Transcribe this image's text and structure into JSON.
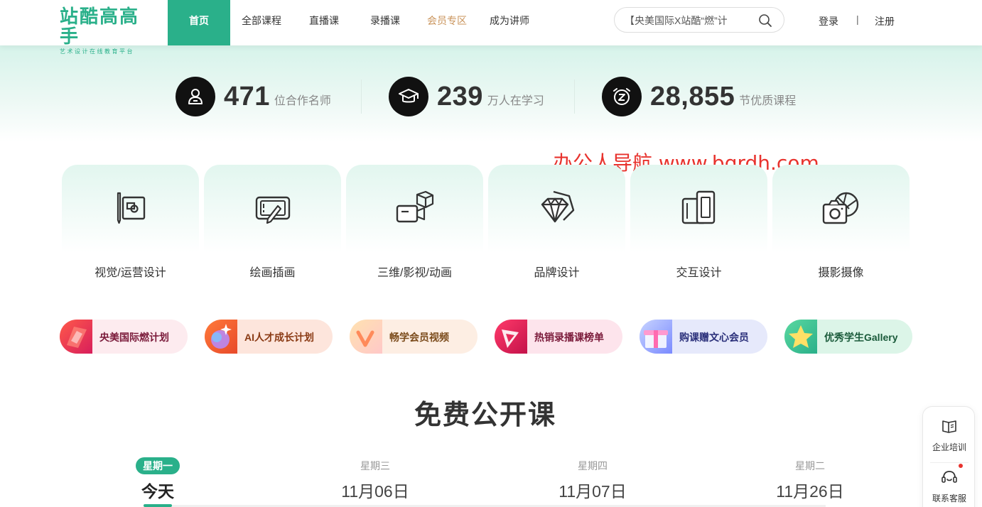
{
  "header": {
    "logo_main": "站酷高高手",
    "logo_sub": "艺术设计在线教育平台",
    "nav": [
      {
        "label": "首页"
      },
      {
        "label": "全部课程"
      },
      {
        "label": "直播课"
      },
      {
        "label": "录播课"
      },
      {
        "label": "会员专区"
      },
      {
        "label": "成为讲师"
      }
    ],
    "search_placeholder": "【央美国际X站酷“燃”计",
    "login": "登录",
    "divider": "|",
    "register": "注册"
  },
  "stats": [
    {
      "num": "471",
      "unit": "位合作名师",
      "icon": "teacher-icon"
    },
    {
      "num": "239",
      "unit": "万人在学习",
      "icon": "graduation-cap-icon"
    },
    {
      "num": "28,855",
      "unit": "节优质课程",
      "icon": "alarm-clock-icon"
    }
  ],
  "watermark": "办公人导航  www.bgrdh.com",
  "categories": [
    {
      "label": "视觉/运营设计",
      "icon": "visual-design-icon"
    },
    {
      "label": "绘画插画",
      "icon": "drawing-tablet-icon"
    },
    {
      "label": "三维/影视/动画",
      "icon": "3d-camera-icon"
    },
    {
      "label": "品牌设计",
      "icon": "diamond-icon"
    },
    {
      "label": "交互设计",
      "icon": "devices-icon"
    },
    {
      "label": "摄影摄像",
      "icon": "camera-icon"
    }
  ],
  "promos": [
    {
      "label": "央美国际燃计划",
      "color": "#7a1a3a",
      "bg": "#fdebef"
    },
    {
      "label": "AI人才成长计划",
      "color": "#8a3a14",
      "bg": "#fde5dc"
    },
    {
      "label": "畅学会员视频",
      "color": "#7a4a1a",
      "bg": "#fdeee3"
    },
    {
      "label": "热销录播课榜单",
      "color": "#7a1a3a",
      "bg": "#fde4ec"
    },
    {
      "label": "购课赠文心会员",
      "color": "#2a2f7a",
      "bg": "#e6e9fb"
    },
    {
      "label": "优秀学生Gallery",
      "color": "#1a5a3a",
      "bg": "#dcf5e8"
    }
  ],
  "free_courses": {
    "title": "免费公开课",
    "days": [
      {
        "name": "星期一",
        "date": "今天"
      },
      {
        "name": "星期三",
        "date": "11月06日"
      },
      {
        "name": "星期四",
        "date": "11月07日"
      },
      {
        "name": "星期二",
        "date": "11月26日"
      }
    ]
  },
  "float_panel": {
    "enterprise": "企业培训",
    "contact": "联系客服"
  },
  "colors": {
    "brand": "#2ab08a",
    "vip": "#c9935a",
    "watermark": "#e8332e"
  }
}
